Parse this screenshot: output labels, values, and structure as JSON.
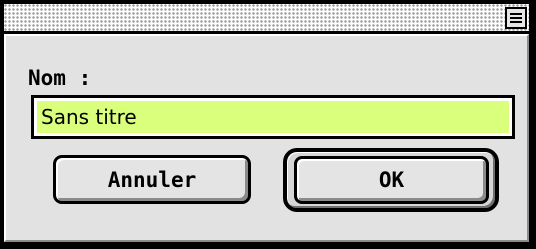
{
  "dialog": {
    "name_label": "Nom :",
    "name_field": {
      "value": "Sans titre",
      "highlight_color": "#daff7c"
    },
    "buttons": {
      "cancel_label": "Annuler",
      "ok_label": "OK",
      "default_button": "OK"
    },
    "title_bar": {
      "zoom_icon": "window-zoom-icon"
    }
  }
}
